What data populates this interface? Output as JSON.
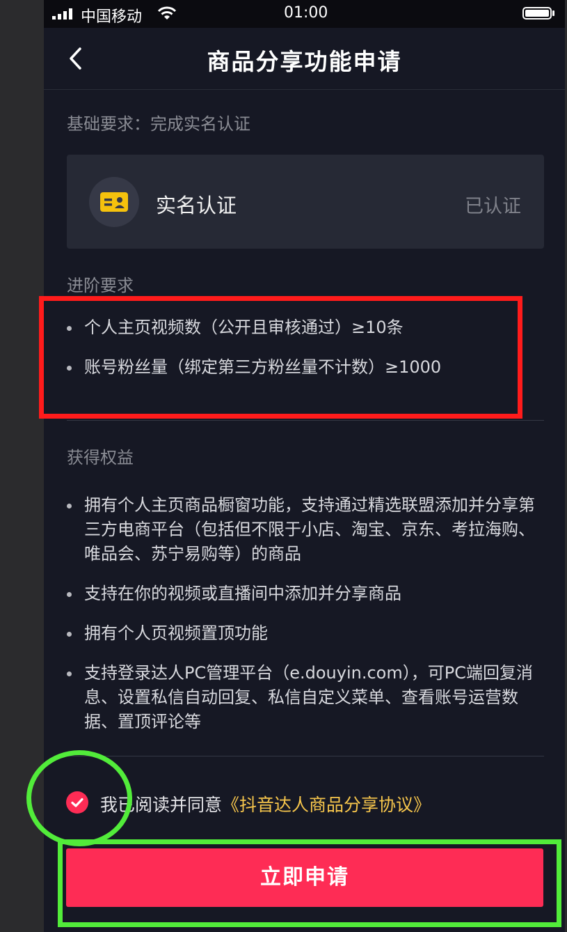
{
  "status_bar": {
    "carrier": "中国移动",
    "time": "01:00"
  },
  "nav": {
    "title": "商品分享功能申请",
    "back_icon": "chevron-left-icon"
  },
  "basic": {
    "label": "基础要求：完成实名认证",
    "card_label": "实名认证",
    "card_status": "已认证",
    "card_icon": "id-card-icon",
    "icon_color": "#f5c20d"
  },
  "advanced": {
    "label": "进阶要求",
    "items": [
      "个人主页视频数（公开且审核通过）≥10条",
      "账号粉丝量（绑定第三方粉丝量不计数）≥1000"
    ]
  },
  "benefits": {
    "label": "获得权益",
    "items": [
      "拥有个人主页商品橱窗功能，支持通过精选联盟添加并分享第三方电商平台（包括但不限于小店、淘宝、京东、考拉海购、唯品会、苏宁易购等）的商品",
      "支持在你的视频或直播间中添加并分享商品",
      "拥有个人页视频置顶功能",
      "支持登录达人PC管理平台（e.douyin.com），可PC端回复消息、设置私信自动回复、私信自定义菜单、查看账号运营数据、置顶评论等"
    ]
  },
  "agreement": {
    "prefix": "我已阅读并同意",
    "link": "《抖音达人商品分享协议》",
    "checked": true
  },
  "submit_label": "立即申请",
  "colors": {
    "accent": "#fe2c55",
    "link": "#f7c64c",
    "annotation_red": "#ff1b1b",
    "annotation_green": "#52ec3a"
  }
}
